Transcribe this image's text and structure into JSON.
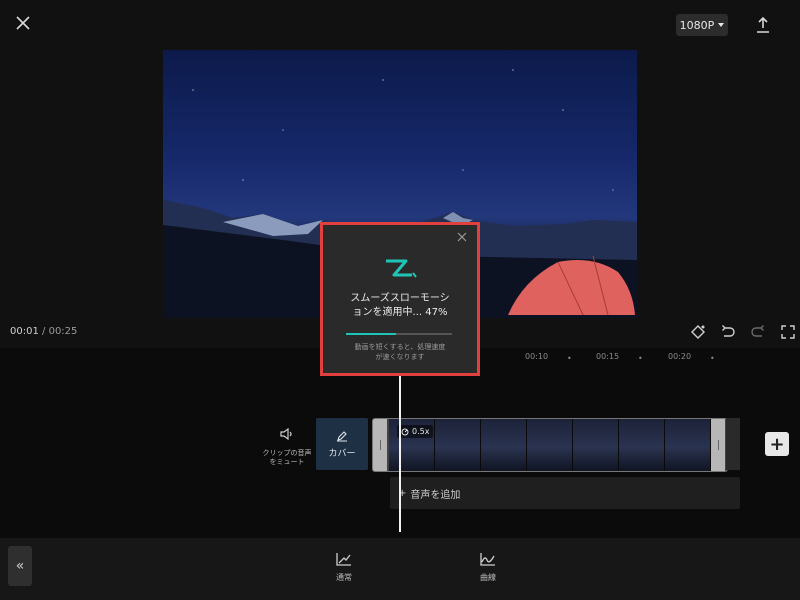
{
  "header": {
    "close_icon": "close-icon",
    "resolution_label": "1080P",
    "export_icon": "upload-icon"
  },
  "preview": {
    "current_time": "00:01",
    "separator": "/",
    "total_time": "00:25",
    "tools": [
      "keyframe-icon",
      "undo-icon",
      "redo-icon",
      "fullscreen-icon"
    ]
  },
  "timeline": {
    "ruler_marks": [
      "00:10",
      "00:15",
      "00:20"
    ],
    "mute_label": "クリップの音声をミュート",
    "cover_label": "カバー",
    "speed_badge": "0.5x",
    "add_audio_label": "音声を追加"
  },
  "bottom_toolbar": {
    "items": [
      {
        "label": "通常",
        "icon": "chart-line-icon"
      },
      {
        "label": "曲線",
        "icon": "curve-chart-icon"
      }
    ]
  },
  "modal": {
    "title_line1": "スムーズスローモーシ",
    "title_line2": "ョンを適用中... 47%",
    "progress": 0.47,
    "hint_line1": "動画を短くすると、処理速度",
    "hint_line2": "が速くなります"
  },
  "colors": {
    "accent": "#1ec5b6",
    "highlight_border": "#e2403e"
  }
}
